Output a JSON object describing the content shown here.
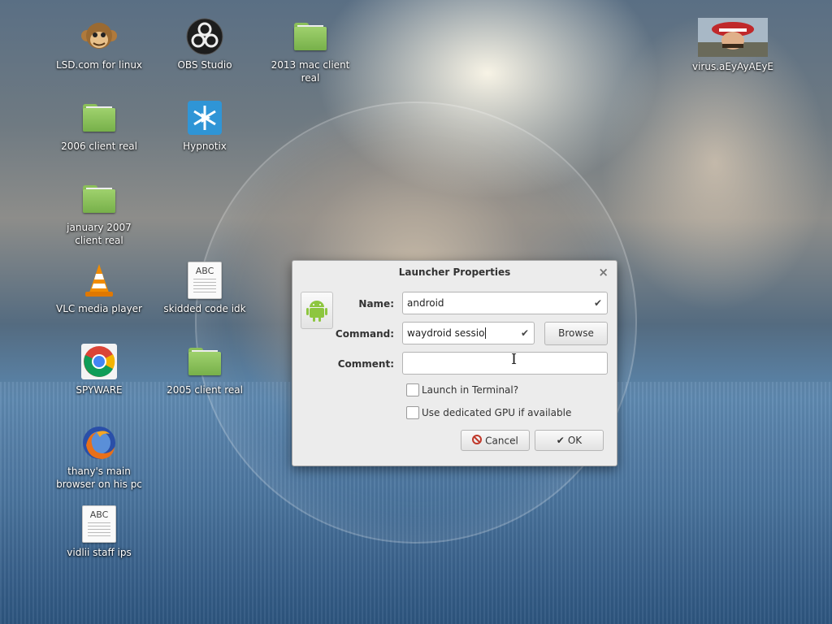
{
  "desktop": {
    "icons": [
      {
        "label": "LSD.com for linux",
        "icon": "monkey-icon"
      },
      {
        "label": "OBS Studio",
        "icon": "obs-icon"
      },
      {
        "label": "2013 mac client\nreal",
        "icon": "folder-icon"
      },
      {
        "label": "virus.aEyAyAEyE",
        "icon": "image-thumbnail-icon"
      },
      {
        "label": "2006 client real",
        "icon": "folder-icon"
      },
      {
        "label": "Hypnotix",
        "icon": "hypnotix-icon"
      },
      {
        "label": "january 2007\nclient real",
        "icon": "folder-icon"
      },
      {
        "label": "VLC media player",
        "icon": "vlc-cone-icon"
      },
      {
        "label": "skidded code idk",
        "icon": "text-document-icon"
      },
      {
        "label": "SPYWARE",
        "icon": "chrome-icon"
      },
      {
        "label": "2005 client real",
        "icon": "folder-icon"
      },
      {
        "label": "thany's main\nbrowser on his pc",
        "icon": "firefox-icon"
      },
      {
        "label": "vidlii staff ips",
        "icon": "text-document-icon"
      }
    ],
    "doc_icon_text": "ABC"
  },
  "dialog": {
    "title": "Launcher Properties",
    "close_glyph": "×",
    "name_label": "Name:",
    "name_value": "android",
    "command_label": "Command:",
    "command_value": "waydroid sessio",
    "comment_label": "Comment:",
    "comment_value": "",
    "browse_label": "Browse",
    "launch_terminal_label": "Launch in Terminal?",
    "launch_terminal_checked": false,
    "gpu_label": "Use dedicated GPU if available",
    "gpu_checked": false,
    "cancel_label": "Cancel",
    "ok_label": "OK",
    "check_glyph": "✔",
    "app_icon": "android-icon"
  },
  "colors": {
    "folder_green": "#8bbf5a",
    "android_green": "#8dc63f",
    "cancel_red": "#c0392b"
  }
}
